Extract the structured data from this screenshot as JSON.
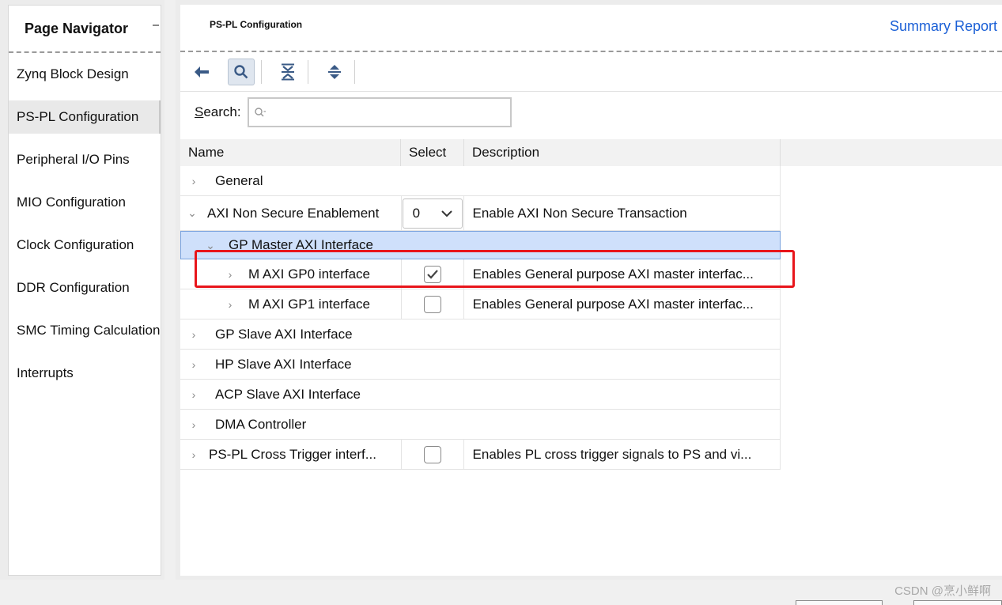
{
  "navigator": {
    "title": "Page Navigator",
    "items": [
      {
        "label": "Zynq Block Design"
      },
      {
        "label": "PS-PL Configuration"
      },
      {
        "label": "Peripheral I/O Pins"
      },
      {
        "label": "MIO Configuration"
      },
      {
        "label": "Clock Configuration"
      },
      {
        "label": "DDR Configuration"
      },
      {
        "label": "SMC Timing Calculation"
      },
      {
        "label": "Interrupts"
      }
    ]
  },
  "main": {
    "title": "PS-PL Configuration",
    "summary_link": "Summary Report",
    "search": {
      "label_prefix": "S",
      "label_rest": "earch:",
      "placeholder": ""
    },
    "columns": {
      "name": "Name",
      "select": "Select",
      "description": "Description"
    },
    "rows": [
      {
        "name": "General",
        "indent": 0,
        "chevron": "›",
        "select": "",
        "description": ""
      },
      {
        "name": "AXI Non Secure Enablement",
        "indent": 0,
        "chevron": "⌄",
        "select_combo": "0",
        "description": "Enable AXI Non Secure Transaction"
      },
      {
        "name": "GP Master AXI Interface",
        "indent": 1,
        "chevron": "⌄",
        "description": ""
      },
      {
        "name": "M AXI GP0 interface",
        "indent": 2,
        "chevron": "›",
        "checked": true,
        "description": "Enables General purpose AXI master interfac..."
      },
      {
        "name": "M AXI GP1 interface",
        "indent": 2,
        "chevron": "›",
        "checked": false,
        "description": "Enables General purpose AXI master interfac..."
      },
      {
        "name": "GP Slave AXI Interface",
        "indent": 0,
        "chevron": "›",
        "description": ""
      },
      {
        "name": "HP Slave AXI Interface",
        "indent": 0,
        "chevron": "›",
        "description": ""
      },
      {
        "name": "ACP Slave AXI Interface",
        "indent": 0,
        "chevron": "›",
        "description": ""
      },
      {
        "name": "DMA Controller",
        "indent": 0,
        "chevron": "›",
        "description": ""
      },
      {
        "name": "PS-PL Cross Trigger interf...",
        "indent": 0,
        "chevron": "›",
        "checked": false,
        "description": "Enables PL cross trigger signals to PS and vi..."
      }
    ]
  },
  "watermark": "CSDN @烹小鲜啊",
  "colors": {
    "link": "#1a5fd6",
    "selected_row": "#cfe0fb",
    "highlight": "#e8151b",
    "toolbar_icon": "#3a5a86"
  }
}
